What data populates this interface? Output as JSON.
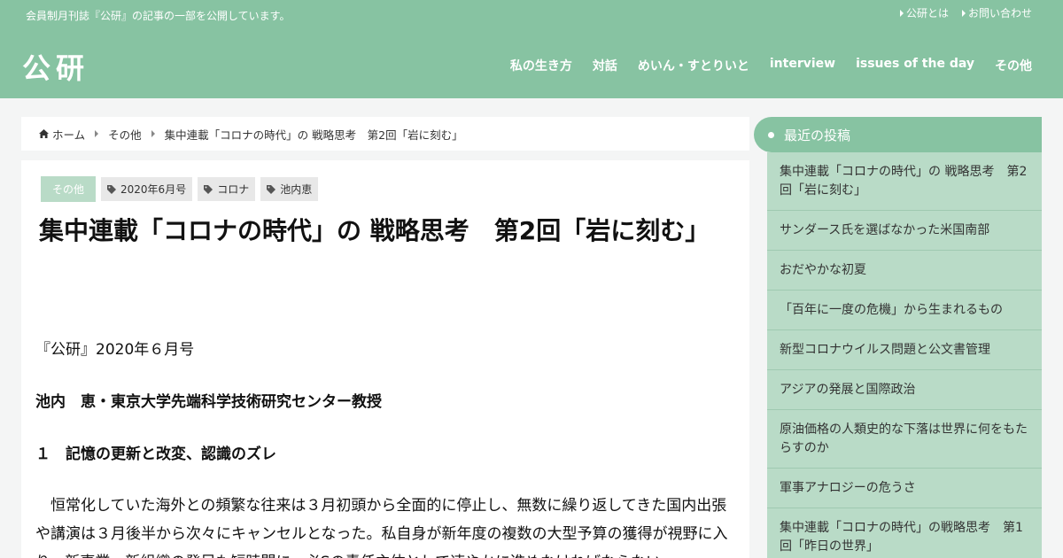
{
  "header": {
    "tagline": "会員制月刊誌『公研』の記事の一部を公開しています。",
    "toplinks": [
      "公研とは",
      "お問い合わせ"
    ],
    "logo": "公研",
    "nav": [
      "私の生き方",
      "対話",
      "めいん・すとりいと",
      "interview",
      "issues of the day",
      "その他"
    ]
  },
  "breadcrumb": {
    "home": "ホーム",
    "category": "その他",
    "current": "集中連載「コロナの時代」の 戦略思考　第2回「岩に刻む」"
  },
  "article": {
    "category": "その他",
    "tags": [
      "2020年6月号",
      "コロナ",
      "池内恵"
    ],
    "title": "集中連載「コロナの時代」の 戦略思考　第2回「岩に刻む」",
    "issue": "『公研』2020年６月号",
    "author": "池内　恵・東京大学先端科学技術研究センター教授",
    "section": "１　記憶の更新と改変、認識のズレ",
    "paragraph": "恒常化していた海外との頻繁な往来は３月初頭から全面的に停止し、無数に繰り返してきた国内出張や講演は３月後半から次々にキャンセルとなった。私自身が新年度の複数の大型予算の獲得が視野に入り、新事業・新組織の発足も短時間に、必Sの責任主体として速やかに進めなければならない"
  },
  "sidebar": {
    "heading": "最近の投稿",
    "posts": [
      "集中連載「コロナの時代」の 戦略思考　第2回「岩に刻む」",
      "サンダース氏を選ばなかった米国南部",
      "おだやかな初夏",
      "「百年に一度の危機」から生まれるもの",
      "新型コロナウイルス問題と公文書管理",
      "アジアの発展と国際政治",
      "原油価格の人類史的な下落は世界に何をもたらすのか",
      "軍事アナロジーの危うさ",
      "集中連載「コロナの時代」の戦略思考　第1回「昨日の世界」"
    ]
  },
  "colors": {
    "brand": "#87c3a2",
    "sidebar_bg": "#b9dbc7",
    "background": "#f4f5f5"
  }
}
